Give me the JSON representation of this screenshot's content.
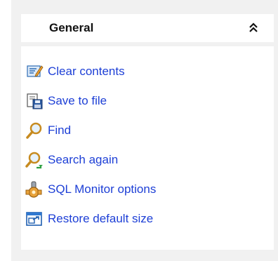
{
  "panel": {
    "title": "General",
    "collapse_glyph": "˄",
    "items": [
      {
        "label": "Clear contents",
        "icon": "clear-contents-icon"
      },
      {
        "label": "Save to file",
        "icon": "save-to-file-icon"
      },
      {
        "label": "Find",
        "icon": "find-icon"
      },
      {
        "label": "Search again",
        "icon": "search-again-icon"
      },
      {
        "label": "SQL Monitor options",
        "icon": "sql-monitor-options-icon"
      },
      {
        "label": "Restore default size",
        "icon": "restore-default-size-icon"
      }
    ]
  }
}
